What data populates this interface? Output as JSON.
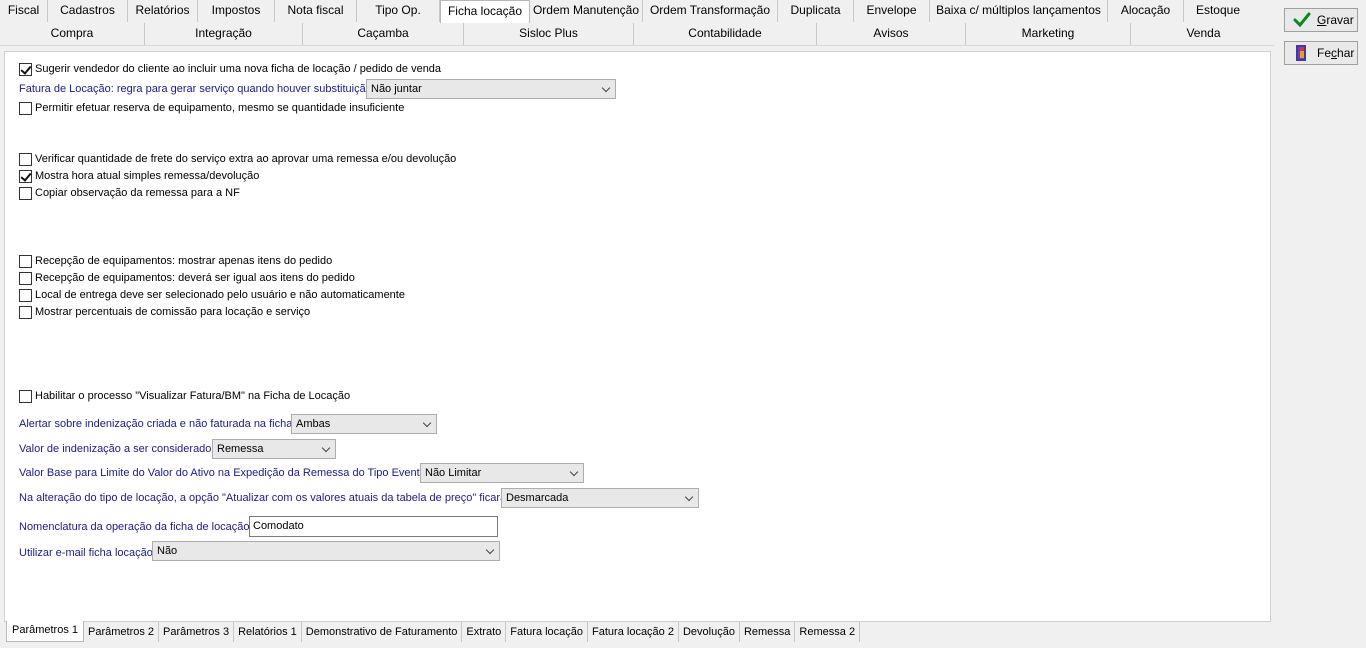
{
  "top_tabs_row1": [
    {
      "label": "Fiscal"
    },
    {
      "label": "Cadastros"
    },
    {
      "label": "Relatórios"
    },
    {
      "label": "Impostos"
    },
    {
      "label": "Nota fiscal"
    },
    {
      "label": "Tipo Op."
    },
    {
      "label": "Ficha locação",
      "active": true
    },
    {
      "label": "Ordem Manutenção"
    },
    {
      "label": "Ordem Transformação"
    },
    {
      "label": "Duplicata"
    },
    {
      "label": "Envelope"
    },
    {
      "label": "Baixa c/ múltiplos lançamentos"
    },
    {
      "label": "Alocação"
    },
    {
      "label": "Estoque"
    }
  ],
  "top_tabs_row2": [
    {
      "label": "Compra"
    },
    {
      "label": "Integração"
    },
    {
      "label": "Caçamba"
    },
    {
      "label": "Sisloc Plus"
    },
    {
      "label": "Contabilidade"
    },
    {
      "label": "Avisos"
    },
    {
      "label": "Marketing"
    },
    {
      "label": "Venda"
    }
  ],
  "buttons": {
    "save": {
      "pre": "",
      "accel": "G",
      "post": "ravar",
      "icon": "check-icon"
    },
    "close": {
      "pre": "Fe",
      "accel": "c",
      "post": "har",
      "icon": "exit-door-icon"
    }
  },
  "options": {
    "sugerir_vendedor": {
      "label": "Sugerir vendedor do cliente ao incluir uma nova ficha de locação / pedido de venda",
      "checked": true
    },
    "fatura_locacao": {
      "label": "Fatura de Locação: regra para gerar serviço quando houver substituição",
      "value": "Não juntar"
    },
    "permitir_reserva": {
      "label": "Permitir efetuar reserva de equipamento, mesmo se quantidade insuficiente",
      "checked": false
    },
    "verificar_frete": {
      "label": "Verificar quantidade de frete do serviço extra ao aprovar uma remessa e/ou devolução",
      "checked": false
    },
    "mostra_hora": {
      "label": "Mostra hora atual simples remessa/devolução",
      "checked": true
    },
    "copiar_obs": {
      "label": "Copiar observação da remessa para a NF",
      "checked": false
    },
    "recepcao_apenas": {
      "label": "Recepção de equipamentos: mostrar apenas itens do pedido",
      "checked": false
    },
    "recepcao_igual": {
      "label": "Recepção de equipamentos: deverá ser igual aos itens do pedido",
      "checked": false
    },
    "local_entrega": {
      "label": "Local de entrega deve ser selecionado pelo usuário e não automaticamente",
      "checked": false
    },
    "mostrar_percentuais": {
      "label": "Mostrar percentuais de comissão para locação e serviço",
      "checked": false
    },
    "habilitar_visualizar": {
      "label": "Habilitar o processo \"Visualizar Fatura/BM\" na Ficha de Locação",
      "checked": false
    },
    "alertar_indenizacao": {
      "label": "Alertar sobre indenização criada e não faturada na ficha",
      "value": "Ambas"
    },
    "valor_indenizacao": {
      "label": "Valor de indenização a ser considerado",
      "value": "Remessa"
    },
    "valor_base": {
      "label": "Valor Base para Limite do Valor do Ativo na Expedição da Remessa do Tipo Evento",
      "value": "Não Limitar"
    },
    "alteracao_tipo": {
      "label": "Na alteração do tipo de locação, a opção \"Atualizar com os valores atuais da tabela de preço\" ficará:",
      "value": "Desmarcada"
    },
    "nomenclatura": {
      "label": "Nomenclatura da operação da ficha de locação",
      "value": "Comodato"
    },
    "utilizar_email": {
      "label": "Utilizar e-mail ficha locação",
      "value": "Não"
    }
  },
  "bottom_tabs": [
    {
      "label": "Parâmetros 1",
      "active": true
    },
    {
      "label": "Parâmetros 2"
    },
    {
      "label": "Parâmetros 3"
    },
    {
      "label": "Relatórios 1"
    },
    {
      "label": "Demonstrativo de Faturamento"
    },
    {
      "label": "Extrato"
    },
    {
      "label": "Fatura locação"
    },
    {
      "label": "Fatura locação 2"
    },
    {
      "label": "Devolução"
    },
    {
      "label": "Remessa"
    },
    {
      "label": "Remessa 2"
    }
  ]
}
